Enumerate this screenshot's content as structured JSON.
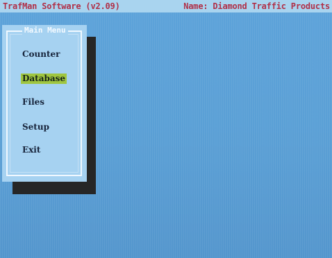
{
  "title_bar": {
    "app_title": "TrafMan Software (v2.09)",
    "name_label": "Name: Diamond Traffic Products"
  },
  "menu": {
    "title": "Main Menu",
    "selected": "Database",
    "items": [
      {
        "label": "Counter"
      },
      {
        "label": "Database"
      },
      {
        "label": "Files"
      },
      {
        "label": "Setup"
      },
      {
        "label": "Exit"
      }
    ]
  },
  "colors": {
    "background": "#5a9fd6",
    "title_bar_bg": "#a9d4ef",
    "title_text": "#b03048",
    "menu_bg": "#a6d2f1",
    "menu_shadow": "#262626",
    "selection_highlight": "#a0c640"
  }
}
